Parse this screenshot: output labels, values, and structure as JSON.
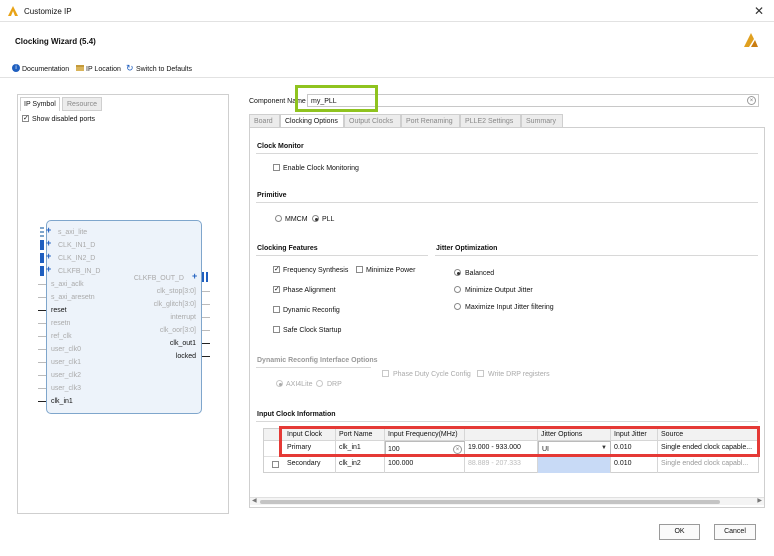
{
  "window": {
    "title": "Customize IP"
  },
  "header": {
    "wizard_title": "Clocking Wizard (5.4)"
  },
  "toolbar": {
    "documentation": "Documentation",
    "ip_location": "IP Location",
    "switch_defaults": "Switch to Defaults"
  },
  "left_panel": {
    "tabs": [
      "IP Symbol",
      "Resource"
    ],
    "show_disabled_label": "Show disabled ports",
    "left_ports": [
      "s_axi_lite",
      "CLK_IN1_D",
      "CLK_IN2_D",
      "CLKFB_IN_D",
      "s_axi_aclk",
      "s_axi_aresetn",
      "reset",
      "resetn",
      "ref_clk",
      "user_clk0",
      "user_clk1",
      "user_clk2",
      "user_clk3",
      "clk_in1"
    ],
    "right_ports": [
      "CLKFB_OUT_D",
      "clk_stop[3:0]",
      "clk_glitch[3:0]",
      "interrupt",
      "clk_oor[3:0]",
      "clk_out1",
      "locked"
    ]
  },
  "component": {
    "label": "Component Name",
    "value": "my_PLL"
  },
  "tabs": [
    "Board",
    "Clocking Options",
    "Output Clocks",
    "Port Renaming",
    "PLLE2 Settings",
    "Summary"
  ],
  "clock_monitor": {
    "title": "Clock Monitor",
    "enable_label": "Enable Clock Monitoring"
  },
  "primitive": {
    "title": "Primitive",
    "mmcm": "MMCM",
    "pll": "PLL"
  },
  "clocking_features": {
    "title": "Clocking Features",
    "frequency_synthesis": "Frequency Synthesis",
    "minimize_power": "Minimize Power",
    "phase_alignment": "Phase Alignment",
    "dynamic_reconfig": "Dynamic Reconfig",
    "safe_clock_startup": "Safe Clock Startup"
  },
  "jitter_opt": {
    "title": "Jitter Optimization",
    "balanced": "Balanced",
    "minimize_output": "Minimize Output Jitter",
    "maximize_input": "Maximize Input Jitter filtering"
  },
  "dynamic_iface": {
    "title": "Dynamic Reconfig Interface Options",
    "axi4lite": "AXI4Lite",
    "drp": "DRP",
    "phase_duty": "Phase Duty Cycle Config",
    "write_drp": "Write DRP registers"
  },
  "input_clock": {
    "title": "Input Clock Information",
    "headers": [
      "Input Clock",
      "Port Name",
      "Input Frequency(MHz)",
      "",
      "Jitter Options",
      "Input Jitter",
      "Source"
    ],
    "rows": [
      {
        "clock": "Primary",
        "port": "clk_in1",
        "freq": "100",
        "range": "19.000 - 933.000",
        "jitter_opt": "UI",
        "jitter": "0.010",
        "source": "Single ended clock capable..."
      },
      {
        "clock": "Secondary",
        "port": "clk_in2",
        "freq": "100.000",
        "range": "88.889 - 207.333",
        "jitter_opt": "",
        "jitter": "0.010",
        "source": "Single ended clock capabl..."
      }
    ]
  },
  "footer": {
    "ok": "OK",
    "cancel": "Cancel"
  },
  "colors": {
    "highlight_green": "#8fc31f",
    "highlight_red": "#e53935",
    "xilinx_logo": "#e0a020",
    "symbol_fill": "#edf3fa",
    "symbol_border": "#7fa6cc"
  }
}
